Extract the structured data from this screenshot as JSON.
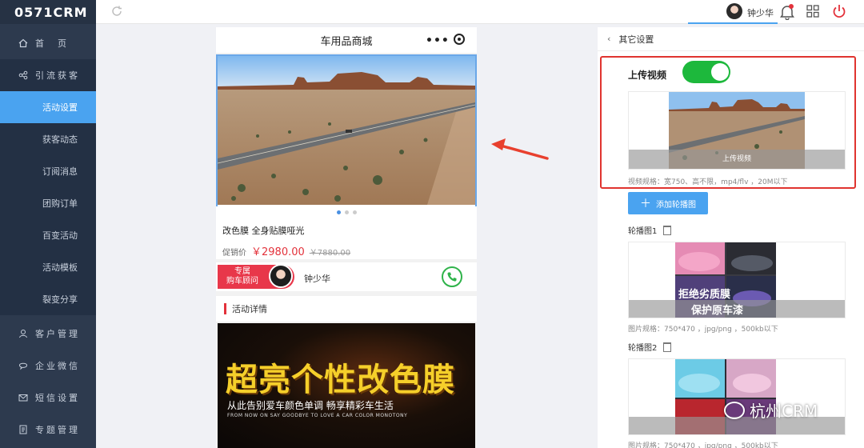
{
  "app": {
    "logo": "0571CRM"
  },
  "sidebar": {
    "items": [
      {
        "label": "首　页",
        "icon": "home-icon",
        "kind": "group"
      },
      {
        "label": "引流获客",
        "icon": "share-icon",
        "kind": "group-open"
      },
      {
        "label": "活动设置",
        "kind": "sub-active"
      },
      {
        "label": "获客动态",
        "kind": "sub"
      },
      {
        "label": "订阅消息",
        "kind": "sub"
      },
      {
        "label": "团购订单",
        "kind": "sub"
      },
      {
        "label": "百变活动",
        "kind": "sub"
      },
      {
        "label": "活动模板",
        "kind": "sub"
      },
      {
        "label": "裂变分享",
        "kind": "sub"
      },
      {
        "label": "客户管理",
        "icon": "user-icon",
        "kind": "group"
      },
      {
        "label": "企业微信",
        "icon": "chat-icon",
        "kind": "group"
      },
      {
        "label": "短信设置",
        "icon": "mail-icon",
        "kind": "group"
      },
      {
        "label": "专题管理",
        "icon": "doc-icon",
        "kind": "group"
      }
    ]
  },
  "topbar": {
    "user_name": "钟少华"
  },
  "phone": {
    "title": "车用品商城",
    "product_title": "改色膜 全身贴膜哑光",
    "price_label": "促销价",
    "price": "￥2980.00",
    "price_old": "￥7880.00",
    "advisor_tag_line1": "专属",
    "advisor_tag_line2": "购车顾问",
    "advisor_name": "钟少华",
    "detail_heading": "活动详情",
    "poster_title": "超亮个性改色膜",
    "poster_subtitle": "从此告别爱车颜色单调  畅享精彩车生活",
    "poster_english": "FROM NOW ON SAY GOODBYE TO LOVE A CAR COLOR MONOTONY"
  },
  "panel": {
    "back_title": "其它设置",
    "upload_video_label": "上传视频",
    "upload_video_enabled": true,
    "video_bar_text": "上传视频",
    "video_spec": "视频规格：宽750、高不限，mp4/flv ，20M以下",
    "add_carousel_button": "添加轮播图",
    "carousel_1_label": "轮播图1",
    "carousel_1_text_a": "拒绝劣质膜",
    "carousel_1_text_b": "保护原车漆",
    "carousel_1_spec": "图片规格：750*470 ，jpg/png ，500kb以下",
    "carousel_2_label": "轮播图2",
    "carousel_2_spec": "图片规格：750*470 ，jpg/png ，500kb以下"
  },
  "watermark": "杭州CRM",
  "colors": {
    "accent": "#4aa3f0",
    "sidebar": "#2d3a4e",
    "price": "#e3323b",
    "toggle": "#1db83c",
    "highlight": "#e0342f"
  }
}
